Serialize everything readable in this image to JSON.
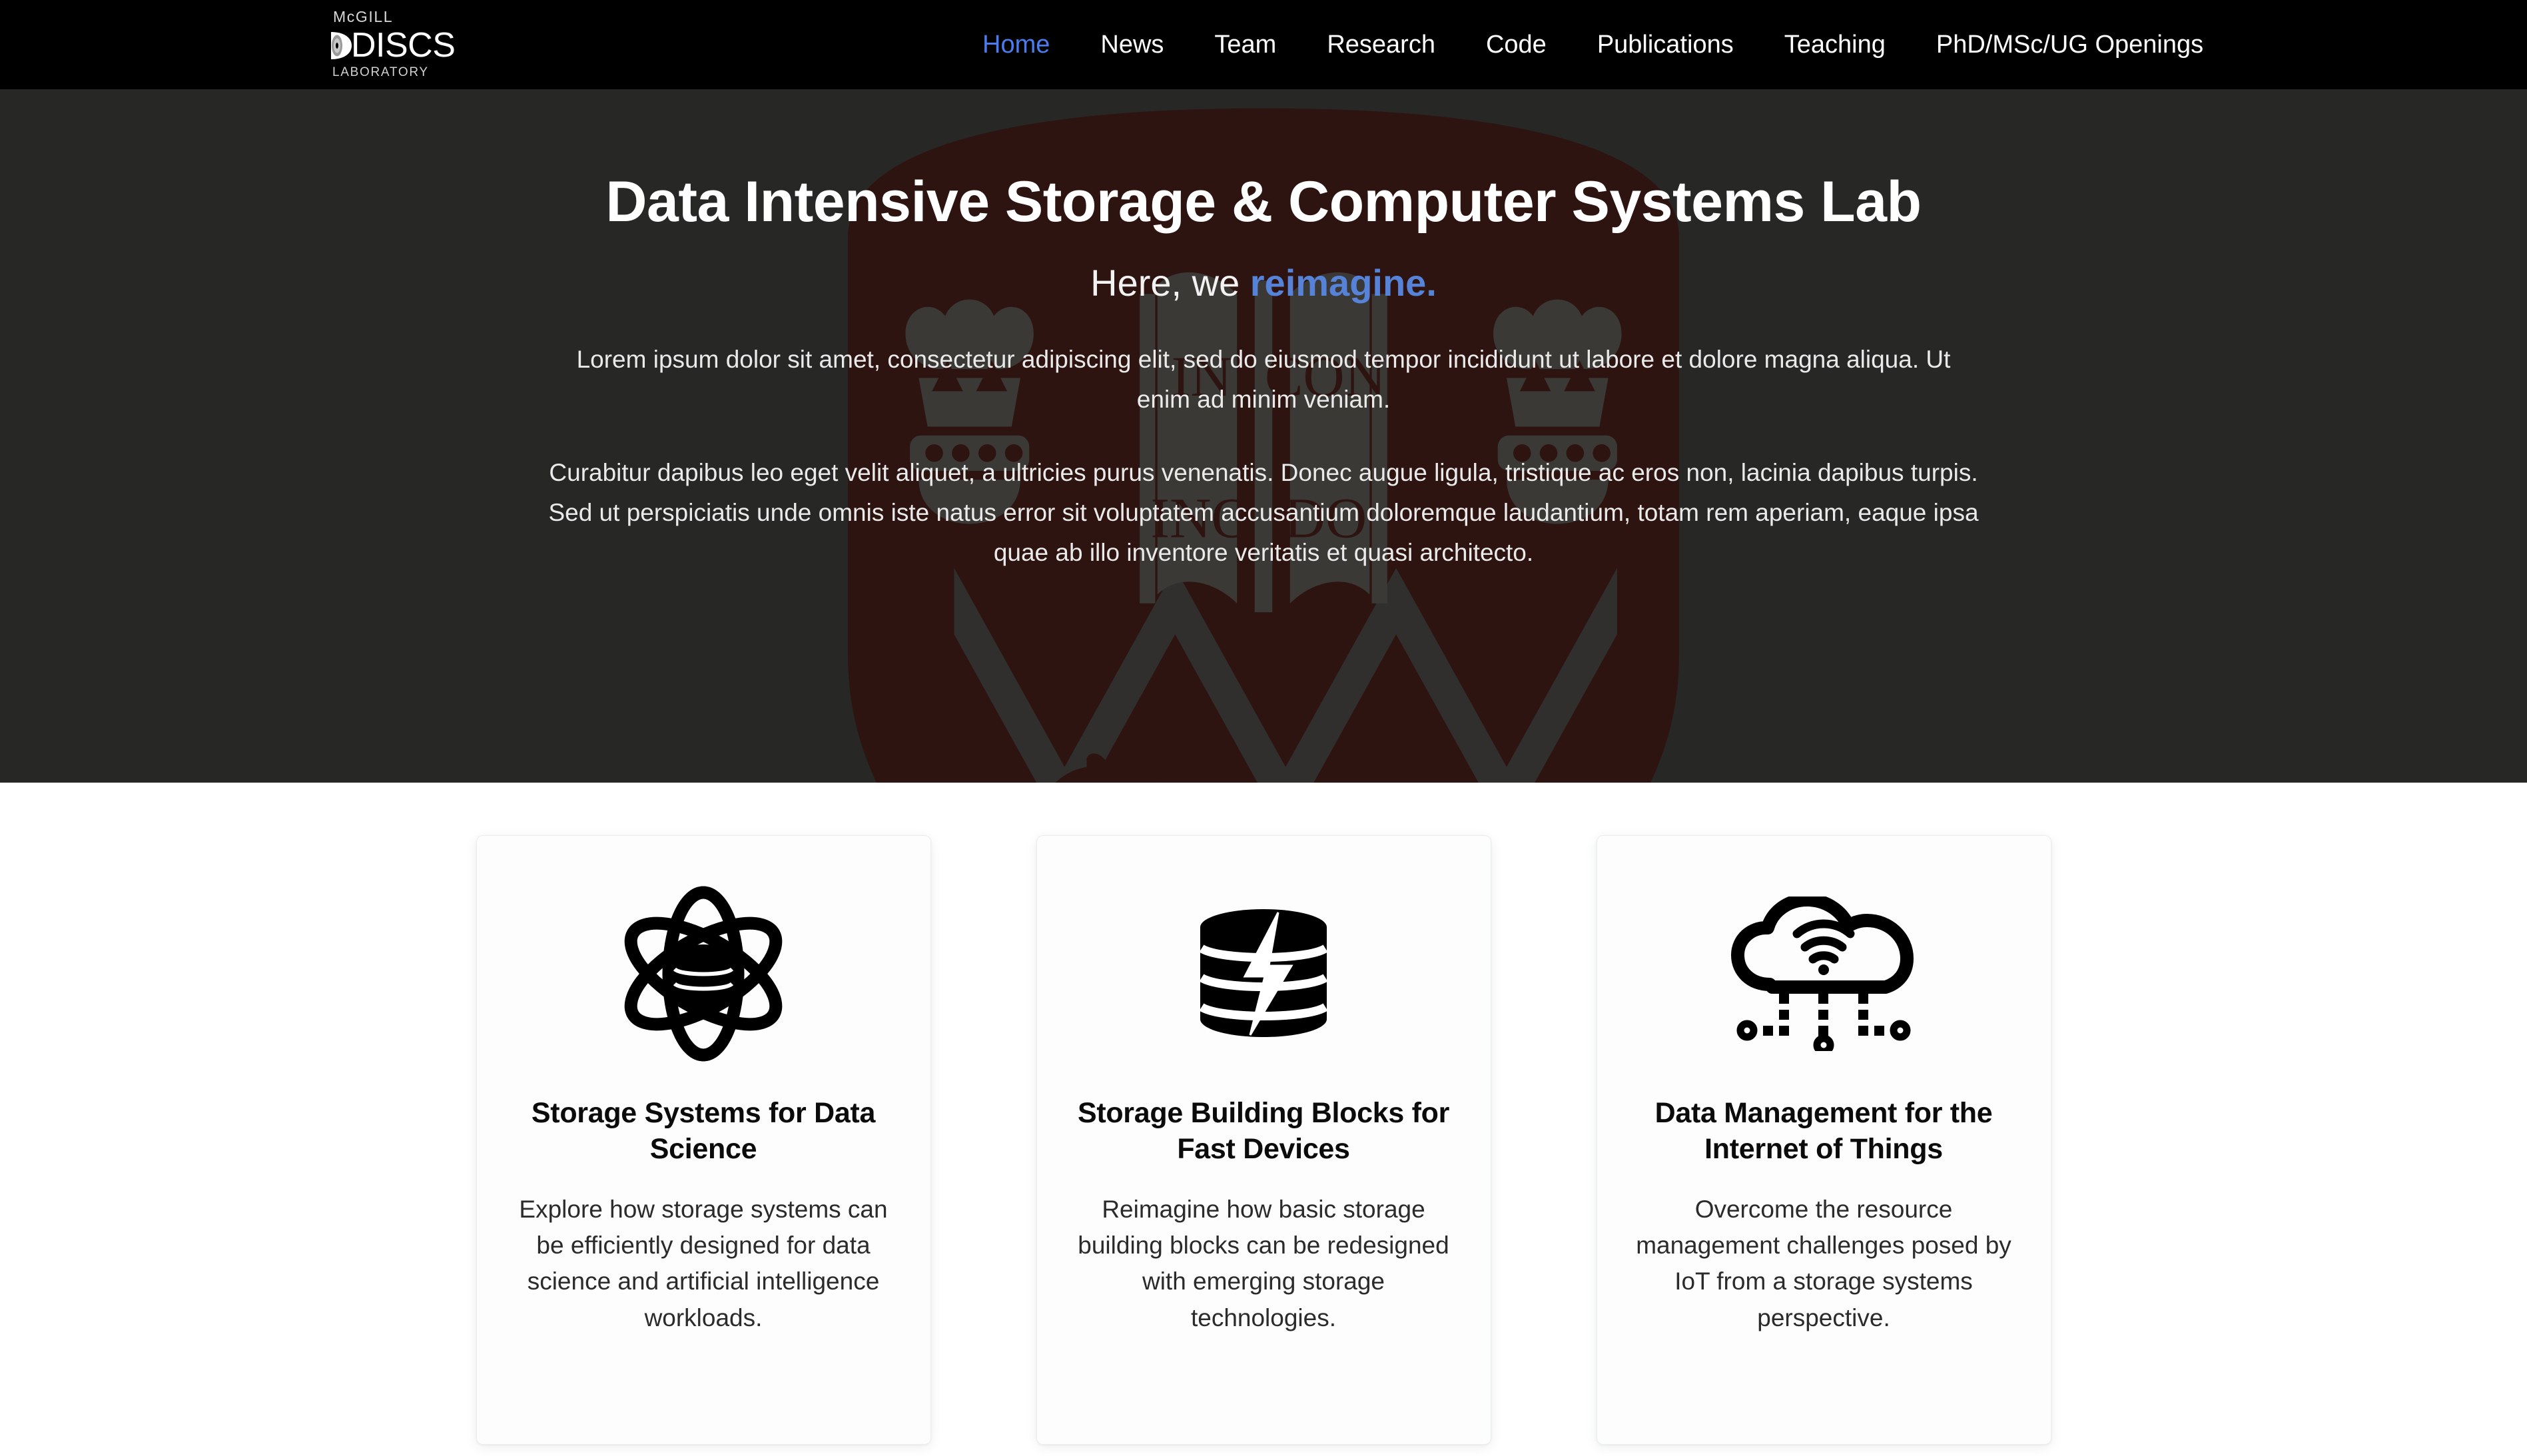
{
  "site": {
    "brand": {
      "top": "McGILL",
      "main": "DISCS",
      "bottom": "LABORATORY",
      "disc_icon": "disc-icon"
    },
    "nav": {
      "items": [
        {
          "label": "Home",
          "active": true
        },
        {
          "label": "News",
          "active": false
        },
        {
          "label": "Team",
          "active": false
        },
        {
          "label": "Research",
          "active": false
        },
        {
          "label": "Code",
          "active": false
        },
        {
          "label": "Publications",
          "active": false
        },
        {
          "label": "Teaching",
          "active": false
        },
        {
          "label": "PhD/MSc/UG Openings",
          "active": false
        }
      ],
      "active_color": "#4a7cf0",
      "background": "#000000"
    }
  },
  "hero": {
    "background": "#272725",
    "watermark": {
      "name": "mcgill-crest-watermark",
      "shield_color": "#2d1411",
      "motto_top_left": "IN",
      "motto_top_right": "CON",
      "motto_bottom_left": "INO",
      "motto_bottom_right": "DO"
    },
    "title": "Data Intensive Storage & Computer Systems Lab",
    "subtitle_prefix": "Here, we ",
    "subtitle_accent": "reimagine.",
    "accent_color": "#5682d8",
    "paragraph1": "Lorem ipsum dolor sit amet, consectetur adipiscing elit, sed do eiusmod tempor incididunt ut labore et dolore magna aliqua. Ut enim ad minim veniam.",
    "paragraph2": "Curabitur dapibus leo eget velit aliquet, a ultricies purus venenatis. Donec augue ligula, tristique ac eros non, lacinia dapibus turpis. Sed ut perspiciatis unde omnis iste natus error sit voluptatem accusantium doloremque laudantium, totam rem aperiam, eaque ipsa quae ab illo inventore veritatis et quasi architecto."
  },
  "cards": [
    {
      "icon": "atom-database-icon",
      "title": "Storage Systems for Data Science",
      "description": "Explore how storage systems can be efficiently designed for data science and artificial intelligence workloads."
    },
    {
      "icon": "database-lightning-icon",
      "title": "Storage Building Blocks for Fast Devices",
      "description": "Reimagine how basic storage building blocks can be redesigned with emerging storage technologies."
    },
    {
      "icon": "cloud-iot-icon",
      "title": "Data Management for the Internet of Things",
      "description": "Overcome the resource management challenges posed by IoT from a storage systems perspective."
    }
  ]
}
